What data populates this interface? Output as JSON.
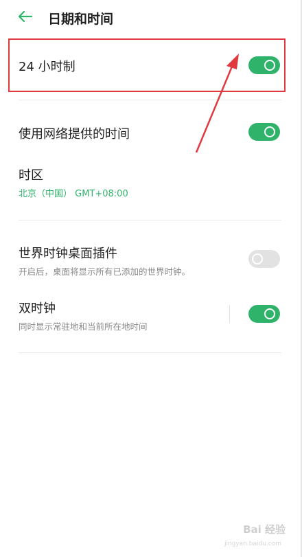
{
  "header": {
    "back_icon": "arrow-left-icon",
    "title": "日期和时间"
  },
  "settings": [
    {
      "label": "24 小时制",
      "toggle": "on"
    },
    {
      "label": "使用网络提供的时间",
      "toggle": "on"
    },
    {
      "label": "时区",
      "value": "北京（中国） GMT+08:00"
    },
    {
      "label": "世界时钟桌面插件",
      "sub": "开启后，桌面将显示所有已添加的世界时钟。",
      "toggle": "off"
    },
    {
      "label": "双时钟",
      "sub": "同时显示常驻地和当前所在地时间",
      "toggle": "on"
    }
  ],
  "annotation": {
    "highlight_color": "#e0393e"
  },
  "colors": {
    "accent": "#2fb36b",
    "toggle_off": "#e2e2e2"
  },
  "watermark": {
    "text": "Bai 经验",
    "sub": "jingyan.baidu.com"
  }
}
